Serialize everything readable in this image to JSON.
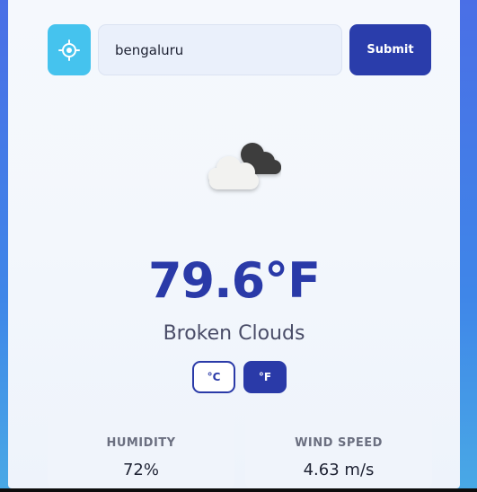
{
  "search": {
    "value": "bengaluru",
    "submit_label": "Submit"
  },
  "locate_icon": "crosshair-location-icon",
  "weather": {
    "icon": "broken-clouds-icon",
    "temperature": "79.6°F",
    "description": "Broken Clouds"
  },
  "units": {
    "celsius_label": "°C",
    "fahrenheit_label": "°F",
    "selected": "°F"
  },
  "stats": {
    "humidity_label": "HUMIDITY",
    "humidity_value": "72%",
    "wind_label": "WIND SPEED",
    "wind_value": "4.63 m/s"
  },
  "colors": {
    "accent": "#2a3aa8",
    "locate_button": "#45c3ee",
    "submit_button": "#2a3dab"
  }
}
